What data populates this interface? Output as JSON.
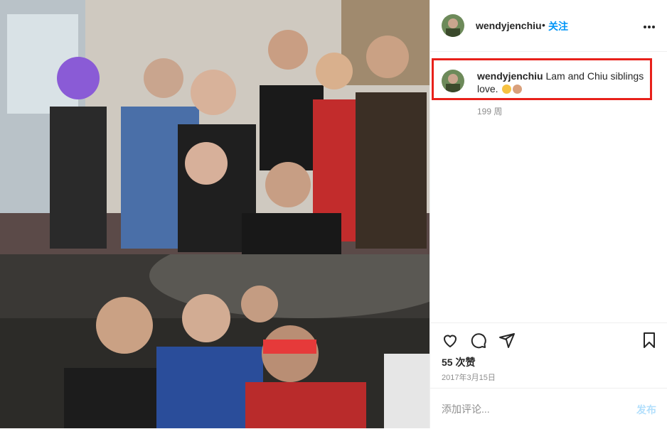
{
  "post": {
    "username": "wendyjenchiu",
    "follow_label": "关注",
    "dot": "•",
    "more_icon": "more-horizontal-icon"
  },
  "caption": {
    "username": "wendyjenchiu",
    "text": "Lam and Chiu siblings love.",
    "emojis": [
      "rolling-laughing-emoji",
      "clapping-hands-emoji"
    ],
    "age": "199 周"
  },
  "actions": {
    "like_icon": "heart-icon",
    "comment_icon": "comment-icon",
    "share_icon": "share-icon",
    "save_icon": "bookmark-icon"
  },
  "likes": "55 次赞",
  "date": "2017年3月15日",
  "comment": {
    "placeholder": "添加评论...",
    "post_label": "发布"
  },
  "colors": {
    "accent": "#0095f6",
    "post_disabled": "#b2dffc",
    "highlight_box": "#e8211b",
    "text": "#262626",
    "muted": "#8e8e8e"
  }
}
